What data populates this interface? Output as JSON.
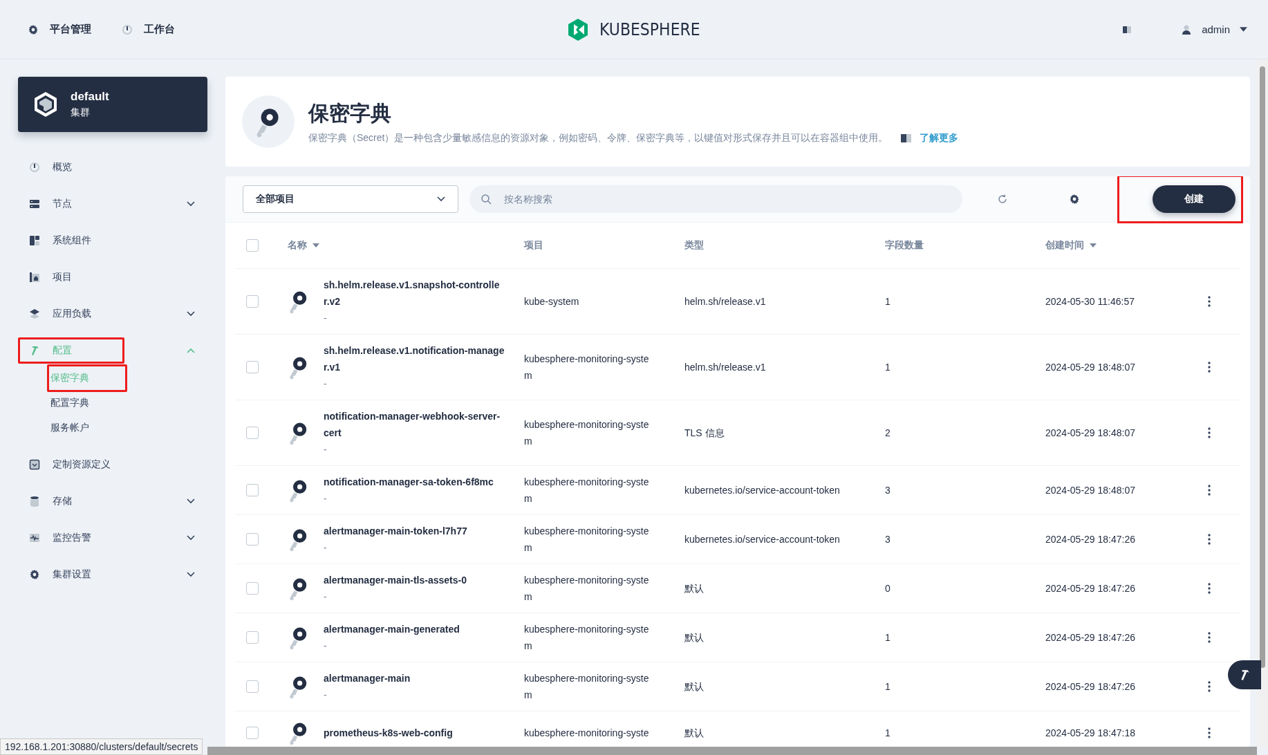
{
  "top_nav": [
    {
      "label": "平台管理",
      "kind": "gear"
    },
    {
      "label": "工作台",
      "kind": "dial"
    }
  ],
  "logo": {
    "text": "KUBESPHERE"
  },
  "user": {
    "name": "admin"
  },
  "cluster": {
    "name": "default",
    "subtitle": "集群"
  },
  "sidebar": {
    "items": [
      {
        "label": "概览",
        "kind": "dial",
        "selected": false
      },
      {
        "label": "节点",
        "kind": "server",
        "selected": false,
        "expanded": false
      },
      {
        "label": "系统组件",
        "kind": "blocks",
        "selected": false
      },
      {
        "label": "项目",
        "kind": "project",
        "selected": false
      },
      {
        "label": "应用负载",
        "kind": "layers",
        "selected": false,
        "expanded": false
      },
      {
        "label": "配置",
        "kind": "hammer",
        "selected": true,
        "expanded": true,
        "highlighted": true,
        "children": [
          {
            "label": "保密字典",
            "selected": true,
            "highlighted": true
          },
          {
            "label": "配置字典",
            "selected": false,
            "highlighted": false
          },
          {
            "label": "服务帐户",
            "selected": false,
            "highlighted": false
          }
        ]
      },
      {
        "label": "定制资源定义",
        "kind": "crd",
        "selected": false
      },
      {
        "label": "存储",
        "kind": "storage",
        "selected": false,
        "expanded": false
      },
      {
        "label": "监控告警",
        "kind": "monitor",
        "selected": false,
        "expanded": false
      },
      {
        "label": "集群设置",
        "kind": "gear",
        "selected": false,
        "expanded": false
      }
    ]
  },
  "header": {
    "title": "保密字典",
    "description": "保密字典（Secret）是一种包含少量敏感信息的资源对象，例如密码、令牌、保密字典等，以键值对形式保存并且可以在容器组中使用。",
    "link": "了解更多"
  },
  "toolbar": {
    "project_select": "全部项目",
    "search": {
      "placeholder": "按名称搜索"
    },
    "create_button": "创建",
    "create_highlighted": true
  },
  "table": {
    "select_all_checked": false,
    "columns": [
      {
        "label": "名称",
        "sortable": true
      },
      {
        "label": "项目",
        "sortable": false
      },
      {
        "label": "类型",
        "sortable": false
      },
      {
        "label": "字段数量",
        "sortable": false
      },
      {
        "label": "创建时间",
        "sortable": true
      }
    ],
    "rows": [
      {
        "name": "sh.helm.release.v1.snapshot-controller.v2",
        "description": "-",
        "project": "kube-system",
        "type": "helm.sh/release.v1",
        "fields": "1",
        "created": "2024-05-30 11:46:57",
        "checked": false
      },
      {
        "name": "sh.helm.release.v1.notification-manager.v1",
        "description": "-",
        "project": "kubesphere-monitoring-system",
        "type": "helm.sh/release.v1",
        "fields": "1",
        "created": "2024-05-29 18:48:07",
        "checked": false
      },
      {
        "name": "notification-manager-webhook-server-cert",
        "description": "-",
        "project": "kubesphere-monitoring-system",
        "type": "TLS 信息",
        "fields": "2",
        "created": "2024-05-29 18:48:07",
        "checked": false
      },
      {
        "name": "notification-manager-sa-token-6f8mc",
        "description": "-",
        "project": "kubesphere-monitoring-system",
        "type": "kubernetes.io/service-account-token",
        "fields": "3",
        "created": "2024-05-29 18:48:07",
        "checked": false
      },
      {
        "name": "alertmanager-main-token-l7h77",
        "description": "-",
        "project": "kubesphere-monitoring-system",
        "type": "kubernetes.io/service-account-token",
        "fields": "3",
        "created": "2024-05-29 18:47:26",
        "checked": false
      },
      {
        "name": "alertmanager-main-tls-assets-0",
        "description": "-",
        "project": "kubesphere-monitoring-system",
        "type": "默认",
        "fields": "0",
        "created": "2024-05-29 18:47:26",
        "checked": false
      },
      {
        "name": "alertmanager-main-generated",
        "description": "-",
        "project": "kubesphere-monitoring-system",
        "type": "默认",
        "fields": "1",
        "created": "2024-05-29 18:47:26",
        "checked": false
      },
      {
        "name": "alertmanager-main",
        "description": "-",
        "project": "kubesphere-monitoring-system",
        "type": "默认",
        "fields": "1",
        "created": "2024-05-29 18:47:26",
        "checked": false
      },
      {
        "name": "prometheus-k8s-web-config",
        "project": "kubesphere-monitoring-syste",
        "type": "默认",
        "fields": "1",
        "created": "2024-05-29 18:47:18",
        "checked": false
      }
    ]
  },
  "status_bar": {
    "url": "192.168.1.201:30880/clusters/default/secrets"
  }
}
